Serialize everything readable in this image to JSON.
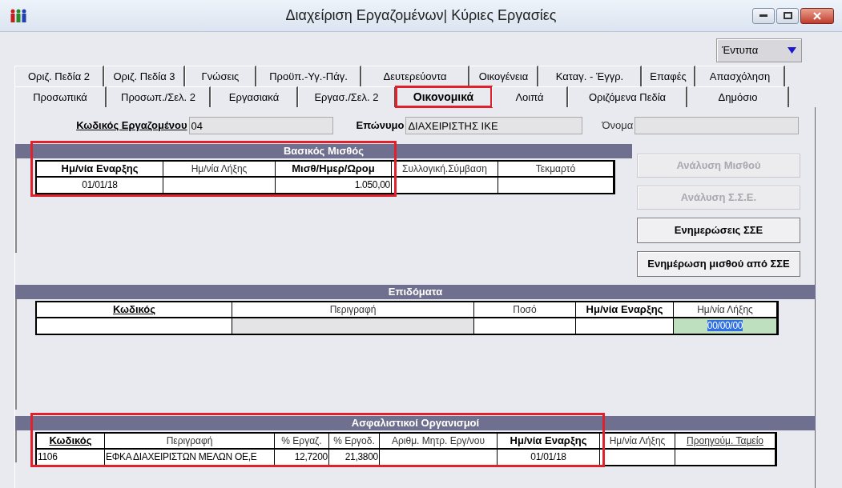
{
  "window": {
    "title": "Διαχείριση Εργαζομένων| Κύριες Εργασίες"
  },
  "printouts_button": {
    "label": "Έντυπα"
  },
  "tab_rows": [
    [
      {
        "label": "Οριζ. Πεδία 2",
        "selected": false,
        "highlighted": false
      },
      {
        "label": "Οριζ. Πεδία 3",
        "selected": false,
        "highlighted": false
      },
      {
        "label": "Γνώσεις",
        "selected": false,
        "highlighted": false
      },
      {
        "label": "Προϋπ.-Υγ.-Πάγ.",
        "selected": false,
        "highlighted": false
      },
      {
        "label": "Δευτερεύοντα",
        "selected": false,
        "highlighted": false
      },
      {
        "label": "Οικογένεια",
        "selected": false,
        "highlighted": false
      },
      {
        "label": "Καταγ. - Έγγρ.",
        "selected": false,
        "highlighted": false
      },
      {
        "label": "Επαφές",
        "selected": false,
        "highlighted": false
      },
      {
        "label": "Απασχόληση",
        "selected": false,
        "highlighted": false
      }
    ],
    [
      {
        "label": "Προσωπικά",
        "selected": false,
        "highlighted": false
      },
      {
        "label": "Προσωπ./Σελ. 2",
        "selected": false,
        "highlighted": false
      },
      {
        "label": "Εργασιακά",
        "selected": false,
        "highlighted": false
      },
      {
        "label": "Εργασ./Σελ. 2",
        "selected": false,
        "highlighted": false
      },
      {
        "label": "Οικονομικά",
        "selected": true,
        "highlighted": true
      },
      {
        "label": "Λοιπά",
        "selected": false,
        "highlighted": false
      },
      {
        "label": "Οριζόμενα Πεδία",
        "selected": false,
        "highlighted": false
      },
      {
        "label": "Δημόσιο",
        "selected": false,
        "highlighted": false
      }
    ]
  ],
  "fields": [
    {
      "label": "Κωδικός Εργαζομένου",
      "value": "04",
      "bold": true,
      "underlined": true
    },
    {
      "label": "Επώνυμο",
      "value": "ΔΙΑΧΕΙΡΙΣΤΗΣ ΙΚΕ",
      "bold": true,
      "underlined": false
    },
    {
      "label": "Όνομα",
      "bold": false,
      "underlined": false
    }
  ],
  "panels": [
    {
      "title": "Βασικός Μισθός",
      "highlighted": true,
      "columns": [
        {
          "label": "Ημ/νία Εναρξης",
          "bold": true,
          "underlined": false
        },
        {
          "label": "Ημ/νία Λήξης",
          "bold": false,
          "underlined": false
        },
        {
          "label": "Μισθ/Ημερ/Ωρομ",
          "bold": true,
          "underlined": false
        },
        {
          "label": "Συλλογική.Σύμβαση",
          "bold": false,
          "underlined": false
        },
        {
          "label": "Τεκμαρτό",
          "bold": false,
          "underlined": false
        }
      ],
      "rows": [
        [
          {
            "value": "01/01/18"
          },
          {},
          {
            "value": "1.050,00"
          },
          {},
          {}
        ]
      ]
    },
    {
      "title": "Επιδόματα",
      "highlighted": false,
      "columns": [
        {
          "label": "Κωδικός",
          "bold": true,
          "underlined": true
        },
        {
          "label": "Περιγραφή",
          "bold": false,
          "underlined": false
        },
        {
          "label": "Ποσό",
          "bold": false,
          "underlined": false
        },
        {
          "label": "Ημ/νία Εναρξης",
          "bold": true,
          "underlined": false
        },
        {
          "label": "Ημ/νία Λήξης",
          "bold": false,
          "underlined": false
        }
      ],
      "rows": [
        [
          {},
          {
            "disabled": true
          },
          {},
          {},
          {
            "value": "00/00/00",
            "selected": true
          }
        ]
      ]
    },
    {
      "title": "Ασφαλιστικοί Οργανισμοί",
      "highlighted": true,
      "columns": [
        {
          "label": "Κωδικός",
          "bold": true,
          "underlined": true
        },
        {
          "label": "Περιγραφή",
          "bold": false,
          "underlined": false
        },
        {
          "label": "% Εργαζ.",
          "bold": false,
          "underlined": false
        },
        {
          "label": "% Εργοδ.",
          "bold": false,
          "underlined": false
        },
        {
          "label": "Αριθμ. Μητρ. Εργ/νου",
          "bold": false,
          "underlined": false
        },
        {
          "label": "Ημ/νία Εναρξης",
          "bold": true,
          "underlined": false
        },
        {
          "label": "Ημ/νία Λήξης",
          "bold": false,
          "underlined": false
        },
        {
          "label": "Προηγούμ. Ταμείο",
          "bold": false,
          "underlined": true
        }
      ],
      "rows": [
        [
          {
            "value": "1106"
          },
          {
            "value": "ΕΦΚΑ ΔΙΑΧΕΙΡΙΣΤΩΝ ΜΕΛΩΝ ΟΕ,Ε"
          },
          {
            "value": "12,7200"
          },
          {
            "value": "21,3800"
          },
          {},
          {
            "value": "01/01/18"
          },
          {},
          {}
        ]
      ]
    }
  ],
  "side_buttons": [
    {
      "label": "Ανάλυση Μισθού",
      "disabled": true
    },
    {
      "label": "Ανάλυση Σ.Σ.Ε.",
      "disabled": true
    },
    {
      "label": "Ενημερώσεις ΣΣΕ",
      "disabled": false
    },
    {
      "label": "Ενημέρωση μισθού από ΣΣΕ",
      "disabled": false
    }
  ]
}
